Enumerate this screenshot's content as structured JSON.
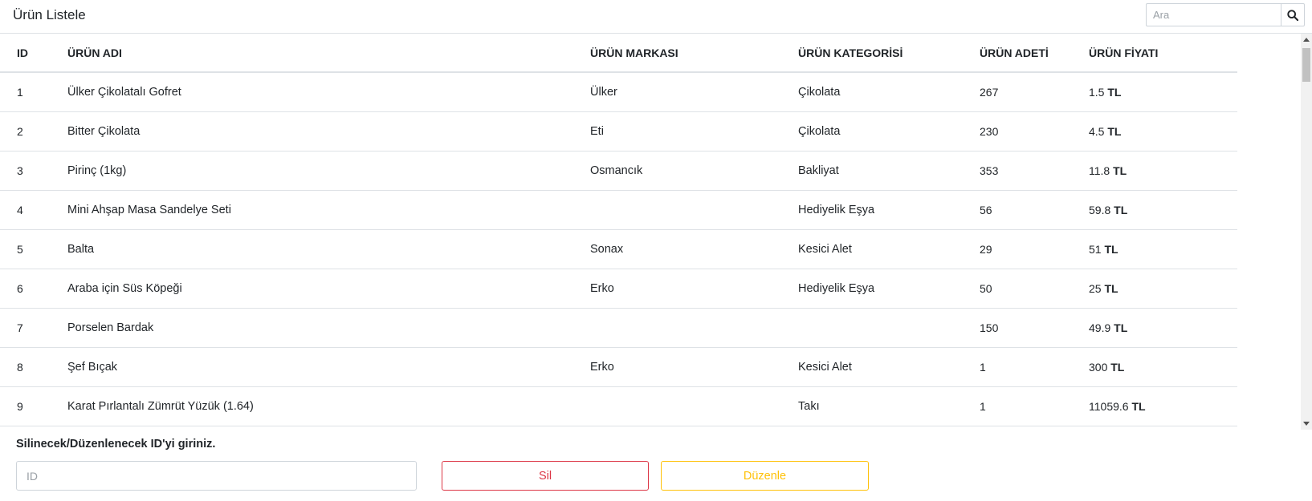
{
  "header": {
    "title": "Ürün Listele",
    "search_placeholder": "Ara",
    "search_icon": "search-icon"
  },
  "table": {
    "columns": [
      "ID",
      "ÜRÜN ADI",
      "ÜRÜN MARKASI",
      "ÜRÜN KATEGORİSİ",
      "ÜRÜN ADETİ",
      "ÜRÜN FİYATI"
    ],
    "currency": "TL",
    "rows": [
      {
        "id": "1",
        "name": "Ülker Çikolatalı Gofret",
        "brand": "Ülker",
        "category": "Çikolata",
        "qty": "267",
        "price": "1.5"
      },
      {
        "id": "2",
        "name": "Bitter Çikolata",
        "brand": "Eti",
        "category": "Çikolata",
        "qty": "230",
        "price": "4.5"
      },
      {
        "id": "3",
        "name": "Pirinç (1kg)",
        "brand": "Osmancık",
        "category": "Bakliyat",
        "qty": "353",
        "price": "11.8"
      },
      {
        "id": "4",
        "name": "Mini Ahşap Masa Sandelye Seti",
        "brand": "",
        "category": "Hediyelik Eşya",
        "qty": "56",
        "price": "59.8"
      },
      {
        "id": "5",
        "name": "Balta",
        "brand": "Sonax",
        "category": "Kesici Alet",
        "qty": "29",
        "price": "51"
      },
      {
        "id": "6",
        "name": "Araba için Süs Köpeği",
        "brand": "Erko",
        "category": "Hediyelik Eşya",
        "qty": "50",
        "price": "25"
      },
      {
        "id": "7",
        "name": "Porselen Bardak",
        "brand": "",
        "category": "",
        "qty": "150",
        "price": "49.9"
      },
      {
        "id": "8",
        "name": "Şef Bıçak",
        "brand": "Erko",
        "category": "Kesici Alet",
        "qty": "1",
        "price": "300"
      },
      {
        "id": "9",
        "name": "Karat Pırlantalı Zümrüt Yüzük (1.64)",
        "brand": "",
        "category": "Takı",
        "qty": "1",
        "price": "11059.6"
      }
    ]
  },
  "form": {
    "label": "Silinecek/Düzenlenecek ID'yi giriniz.",
    "id_placeholder": "ID",
    "id_value": "",
    "delete_label": "Sil",
    "edit_label": "Düzenle"
  },
  "colors": {
    "delete": "#dc3545",
    "edit": "#ffc107",
    "border": "#dee2e6"
  }
}
